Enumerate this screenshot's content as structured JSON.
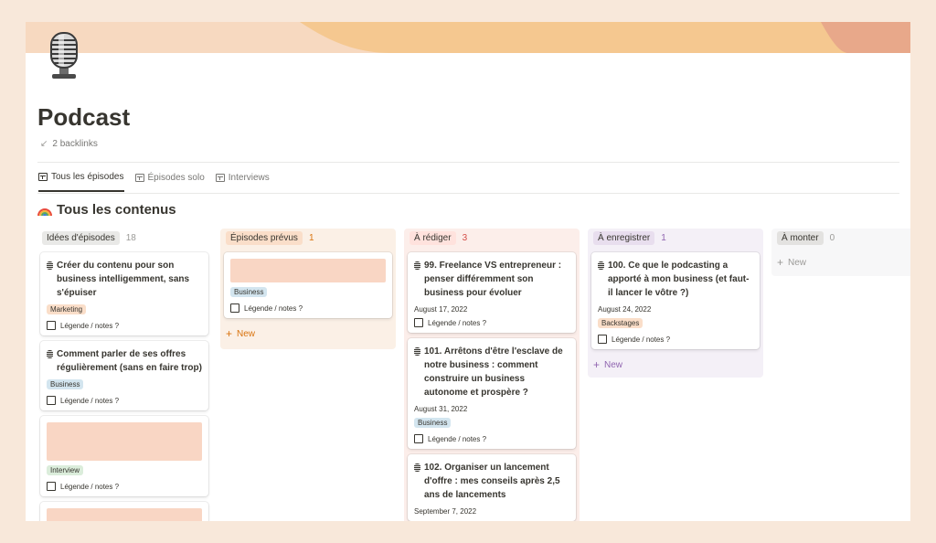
{
  "page": {
    "title": "Podcast",
    "backlinks": "2 backlinks",
    "section_title": "Tous les contenus"
  },
  "tabs": [
    {
      "label": "Tous les épisodes",
      "active": true
    },
    {
      "label": "Épisodes solo",
      "active": false
    },
    {
      "label": "Interviews",
      "active": false
    }
  ],
  "colors": {
    "cover_left": "#f7d9c0",
    "cover_mid": "#f5c890",
    "cover_right": "#e8a88a",
    "col_gray": "#f1f1ef",
    "col_orange": "#fbf0e6",
    "col_red": "#fceeea",
    "col_purple": "#f4f0f7",
    "col_last": "#f7f7f8",
    "tag_marketing": "#fadec9",
    "tag_business": "#d3e5ef",
    "tag_interview": "#dbeddb",
    "tag_backstages": "#fadec9",
    "card_cover": "#f9d6c4"
  },
  "columns": [
    {
      "name": "Idées d'épisodes",
      "count": "18",
      "cards": [
        {
          "title": "Créer du contenu pour son business intelligemment, sans s'épuiser",
          "tag": "Marketing",
          "notes": "Légende / notes ?"
        },
        {
          "title": "Comment parler de ses offres régulièrement (sans en faire trop)",
          "tag": "Business",
          "notes": "Légende / notes ?"
        },
        {
          "tag": "Interview",
          "notes": "Légende / notes ?"
        }
      ]
    },
    {
      "name": "Épisodes prévus",
      "count": "1",
      "cards": [
        {
          "tag": "Business",
          "notes": "Légende / notes ?"
        }
      ],
      "new_label": "New"
    },
    {
      "name": "À rédiger",
      "count": "3",
      "cards": [
        {
          "title": "99. Freelance VS entrepreneur : penser différemment son business pour évoluer",
          "date": "August 17, 2022",
          "notes": "Légende / notes ?"
        },
        {
          "title": "101. Arrêtons d'être l'esclave de notre business : comment construire un business autonome et prospère ?",
          "date": "August 31, 2022",
          "tag": "Business",
          "notes": "Légende / notes ?"
        },
        {
          "title": "102. Organiser un lancement d'offre : mes conseils après 2,5 ans de lancements",
          "date": "September 7, 2022"
        }
      ]
    },
    {
      "name": "À enregistrer",
      "count": "1",
      "cards": [
        {
          "title": "100. Ce que le podcasting a apporté à mon business (et faut-il lancer le vôtre ?)",
          "date": "August 24, 2022",
          "tag": "Backstages",
          "notes": "Légende / notes ?"
        }
      ],
      "new_label": "New"
    },
    {
      "name": "À monter",
      "count": "0",
      "new_label": "New"
    }
  ]
}
